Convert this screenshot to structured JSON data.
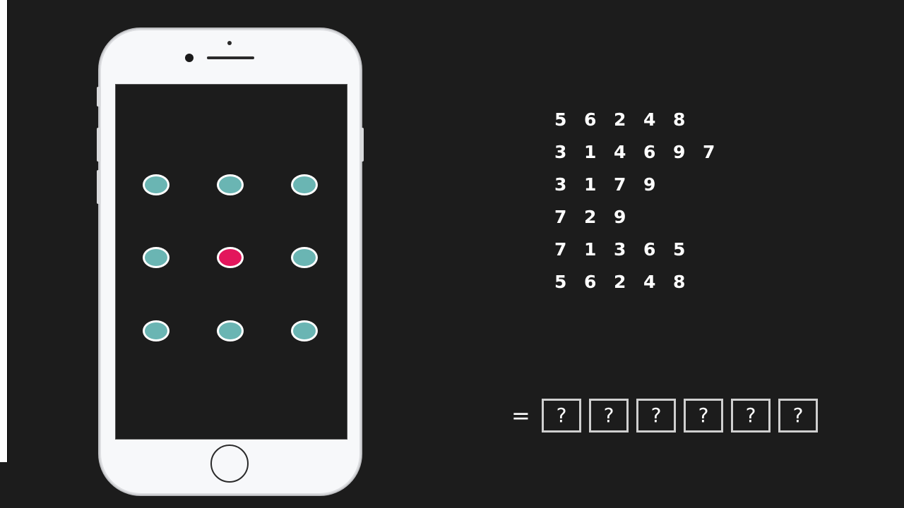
{
  "colors": {
    "background": "#1c1c1c",
    "dot_default": "#6ab5b3",
    "dot_active": "#e3165c",
    "text": "#ffffff"
  },
  "pattern_grid": {
    "dots": [
      {
        "id": "dot-1",
        "state": "default"
      },
      {
        "id": "dot-2",
        "state": "default"
      },
      {
        "id": "dot-3",
        "state": "default"
      },
      {
        "id": "dot-4",
        "state": "default"
      },
      {
        "id": "dot-5",
        "state": "active"
      },
      {
        "id": "dot-6",
        "state": "default"
      },
      {
        "id": "dot-7",
        "state": "default"
      },
      {
        "id": "dot-8",
        "state": "default"
      },
      {
        "id": "dot-9",
        "state": "default"
      }
    ]
  },
  "sequences": [
    [
      "5",
      "6",
      "2",
      "4",
      "8"
    ],
    [
      "3",
      "1",
      "4",
      "6",
      "9",
      "7"
    ],
    [
      "3",
      "1",
      "7",
      "9"
    ],
    [
      "7",
      "2",
      "9"
    ],
    [
      "7",
      "1",
      "3",
      "6",
      "5"
    ],
    [
      "5",
      "6",
      "2",
      "4",
      "8"
    ]
  ],
  "answer": {
    "equals": "=",
    "boxes": [
      "?",
      "?",
      "?",
      "?",
      "?",
      "?"
    ]
  }
}
